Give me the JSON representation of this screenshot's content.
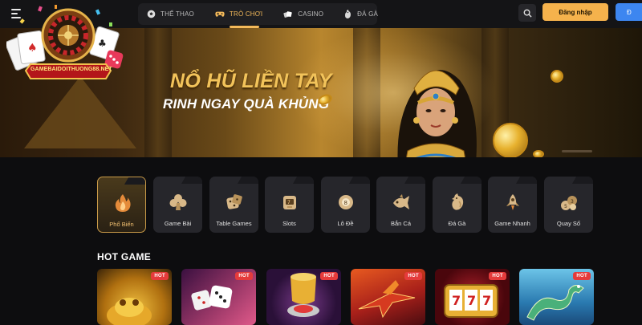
{
  "logo": {
    "text": "GAMEBAIDOITHUONG88.NET"
  },
  "nav": [
    {
      "label": "THỂ THAO",
      "icon": "soccer-ball-icon",
      "active": false
    },
    {
      "label": "TRÒ CHƠI",
      "icon": "game-controller-icon",
      "active": true
    },
    {
      "label": "CASINO",
      "icon": "cards-icon",
      "active": false
    },
    {
      "label": "ĐÁ GÀ",
      "icon": "rooster-icon",
      "active": false
    }
  ],
  "header": {
    "search_icon": "search-icon",
    "login_label": "Đăng nhập",
    "register_label": "Đ"
  },
  "banner": {
    "title": "NỔ HŨ LIỀN TAY",
    "subtitle": "RINH NGAY QUÀ KHỦNG"
  },
  "categories": [
    {
      "label": "Phổ Biến",
      "icon": "flame-icon",
      "active": true
    },
    {
      "label": "Game Bài",
      "icon": "club-icon",
      "active": false
    },
    {
      "label": "Table Games",
      "icon": "dice-icon",
      "active": false
    },
    {
      "label": "Slots",
      "icon": "slot-machine-icon",
      "active": false
    },
    {
      "label": "Lô Đề",
      "icon": "lottery-ball-icon",
      "active": false
    },
    {
      "label": "Bắn Cá",
      "icon": "fish-icon",
      "active": false
    },
    {
      "label": "Đá Gà",
      "icon": "rooster-icon",
      "active": false
    },
    {
      "label": "Game Nhanh",
      "icon": "rocket-icon",
      "active": false
    },
    {
      "label": "Quay Số",
      "icon": "lottery-balls-icon",
      "active": false
    }
  ],
  "hot_game": {
    "title": "HOT GAME",
    "badge": "HOT",
    "cards": [
      {
        "name": "golden-toad-game",
        "color": "#c9871a"
      },
      {
        "name": "dice-game",
        "color": "#7a2a4a"
      },
      {
        "name": "sicbo-cup-game",
        "color": "#3a1a4a"
      },
      {
        "name": "jet-crash-game",
        "color": "#c8371a"
      },
      {
        "name": "slot-777-game",
        "color": "#6a0e12"
      },
      {
        "name": "dragon-game",
        "color": "#3a8ab8"
      }
    ]
  }
}
